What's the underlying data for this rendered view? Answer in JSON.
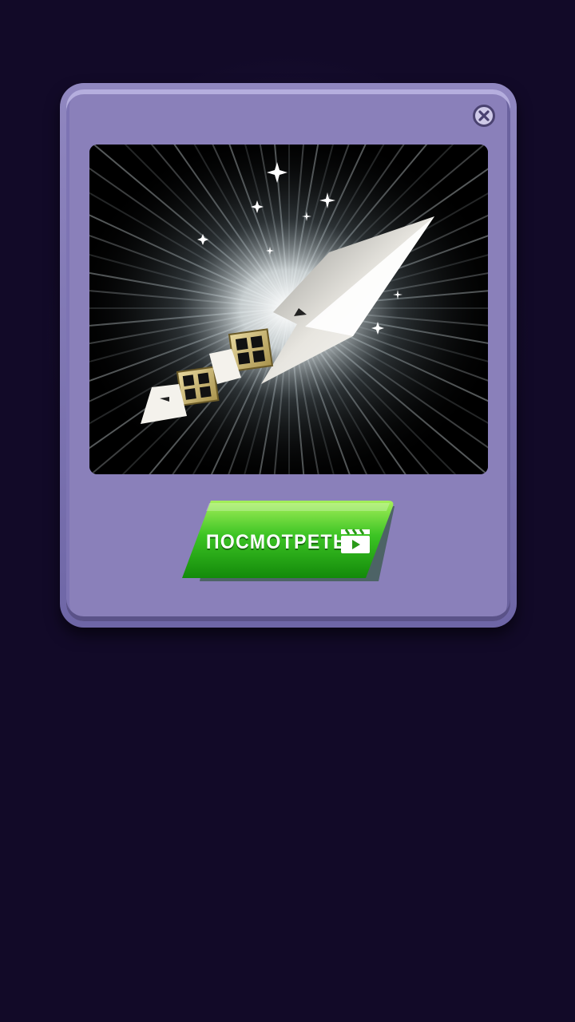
{
  "dialog": {
    "close_icon": "close-icon",
    "reward_image": "knife-reward-image",
    "watch_button": {
      "label": "ПОСМОТРЕТЬ",
      "icon": "video-clapper-icon",
      "color": "#2db51c"
    }
  },
  "colors": {
    "background": "#120a28",
    "panel": "#8a80ba",
    "button_green": "#2db51c"
  }
}
